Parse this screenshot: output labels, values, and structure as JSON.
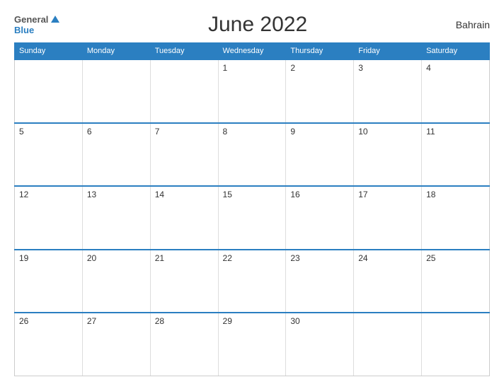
{
  "header": {
    "logo_general": "General",
    "logo_blue": "Blue",
    "title": "June 2022",
    "country": "Bahrain"
  },
  "calendar": {
    "days_of_week": [
      "Sunday",
      "Monday",
      "Tuesday",
      "Wednesday",
      "Thursday",
      "Friday",
      "Saturday"
    ],
    "weeks": [
      [
        null,
        null,
        null,
        1,
        2,
        3,
        4
      ],
      [
        5,
        6,
        7,
        8,
        9,
        10,
        11
      ],
      [
        12,
        13,
        14,
        15,
        16,
        17,
        18
      ],
      [
        19,
        20,
        21,
        22,
        23,
        24,
        25
      ],
      [
        26,
        27,
        28,
        29,
        30,
        null,
        null
      ]
    ]
  }
}
